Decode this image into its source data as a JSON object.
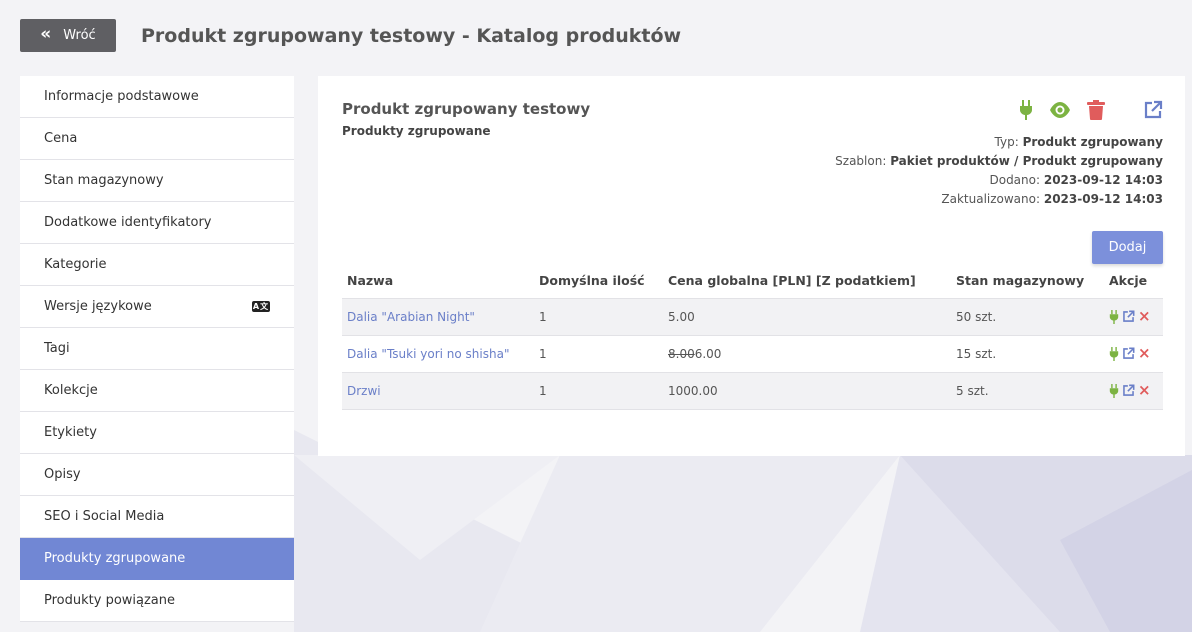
{
  "header": {
    "back_label": "Wróć",
    "page_title": "Produkt zgrupowany testowy - Katalog produktów"
  },
  "sidebar": {
    "items": [
      {
        "label": "Informacje podstawowe"
      },
      {
        "label": "Cena"
      },
      {
        "label": "Stan magazynowy"
      },
      {
        "label": "Dodatkowe identyfikatory"
      },
      {
        "label": "Kategorie"
      },
      {
        "label": "Wersje językowe",
        "icon": "language-icon",
        "icon_text": "A文"
      },
      {
        "label": "Tagi"
      },
      {
        "label": "Kolekcje"
      },
      {
        "label": "Etykiety"
      },
      {
        "label": "Opisy"
      },
      {
        "label": "SEO i Social Media"
      },
      {
        "label": "Produkty zgrupowane",
        "active": true
      },
      {
        "label": "Produkty powiązane"
      }
    ]
  },
  "product": {
    "name": "Produkt zgrupowany testowy",
    "section": "Produkty zgrupowane",
    "meta": {
      "type_label": "Typ:",
      "type_value": "Produkt zgrupowany",
      "template_label": "Szablon:",
      "template_value": "Pakiet produktów / Produkt zgrupowany",
      "added_label": "Dodano:",
      "added_value": "2023-09-12 14:03",
      "updated_label": "Zaktualizowano:",
      "updated_value": "2023-09-12 14:03"
    },
    "actions": {
      "plug_icon": "plug-icon",
      "preview_icon": "eye-icon",
      "delete_icon": "trash-icon",
      "open_icon": "external-link-icon"
    }
  },
  "add_button": "Dodaj",
  "table": {
    "headers": {
      "name": "Nazwa",
      "qty": "Domyślna ilość",
      "price": "Cena globalna [PLN] [Z podatkiem]",
      "stock": "Stan magazynowy",
      "actions": "Akcje"
    },
    "rows": [
      {
        "name": "Dalia \"Arabian Night\"",
        "qty": "1",
        "price_old": "",
        "price": "5.00",
        "stock": "50 szt."
      },
      {
        "name": "Dalia \"Tsuki yori no shisha\"",
        "qty": "1",
        "price_old": "8.00",
        "price": "6.00",
        "stock": "15 szt."
      },
      {
        "name": "Drzwi",
        "qty": "1",
        "price_old": "",
        "price": "1000.00",
        "stock": "5 szt."
      }
    ]
  },
  "colors": {
    "accent": "#7187d4",
    "button": "#7c90db",
    "green": "#7cb342",
    "red": "#e05c5c",
    "link": "#6a7fc8"
  }
}
